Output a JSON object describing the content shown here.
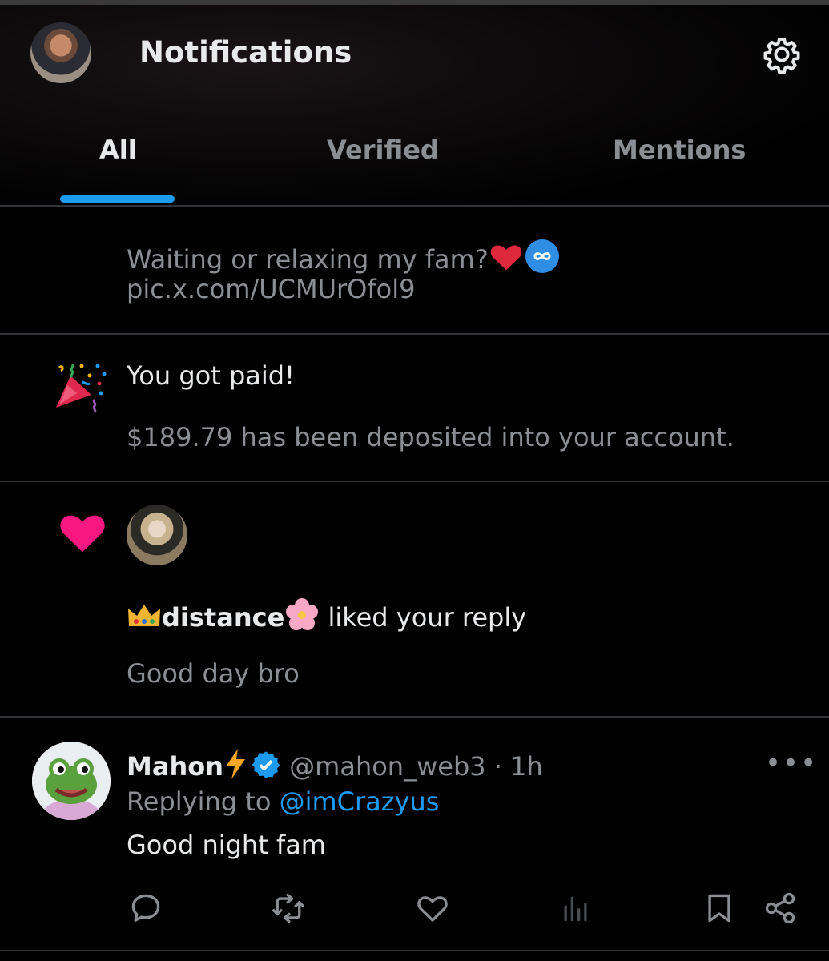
{
  "header": {
    "title": "Notifications",
    "avatar": "profile-photo",
    "settings_icon": "gear-icon"
  },
  "tabs": [
    {
      "label": "All",
      "active": true
    },
    {
      "label": "Verified",
      "active": false
    },
    {
      "label": "Mentions",
      "active": false
    }
  ],
  "colors": {
    "accent": "#1d9bf0",
    "background": "#000000",
    "muted_text": "#8b8f94",
    "like_pink": "#f91880"
  },
  "notifications": {
    "post_preview": {
      "line1": "Waiting or relaxing my fam?",
      "line2": "pic.x.com/UCMUrOfol9"
    },
    "payment": {
      "icon": "party-popper-icon",
      "title": "You got paid!",
      "detail": "$189.79 has been deposited into your account."
    },
    "like": {
      "icon": "heart-icon",
      "user_name": "distance",
      "action": "liked your reply",
      "reply_text": "Good day bro"
    }
  },
  "reply": {
    "name": "Mahon",
    "handle": "@mahon_web3",
    "separator": "·",
    "time": "1h",
    "replying_prefix": "Replying to",
    "replying_to": "@imCrazyus",
    "text": "Good night fam",
    "more_label": "•••",
    "actions": [
      "reply-icon",
      "repost-icon",
      "like-icon",
      "views-icon",
      "bookmark-icon",
      "share-icon"
    ]
  }
}
